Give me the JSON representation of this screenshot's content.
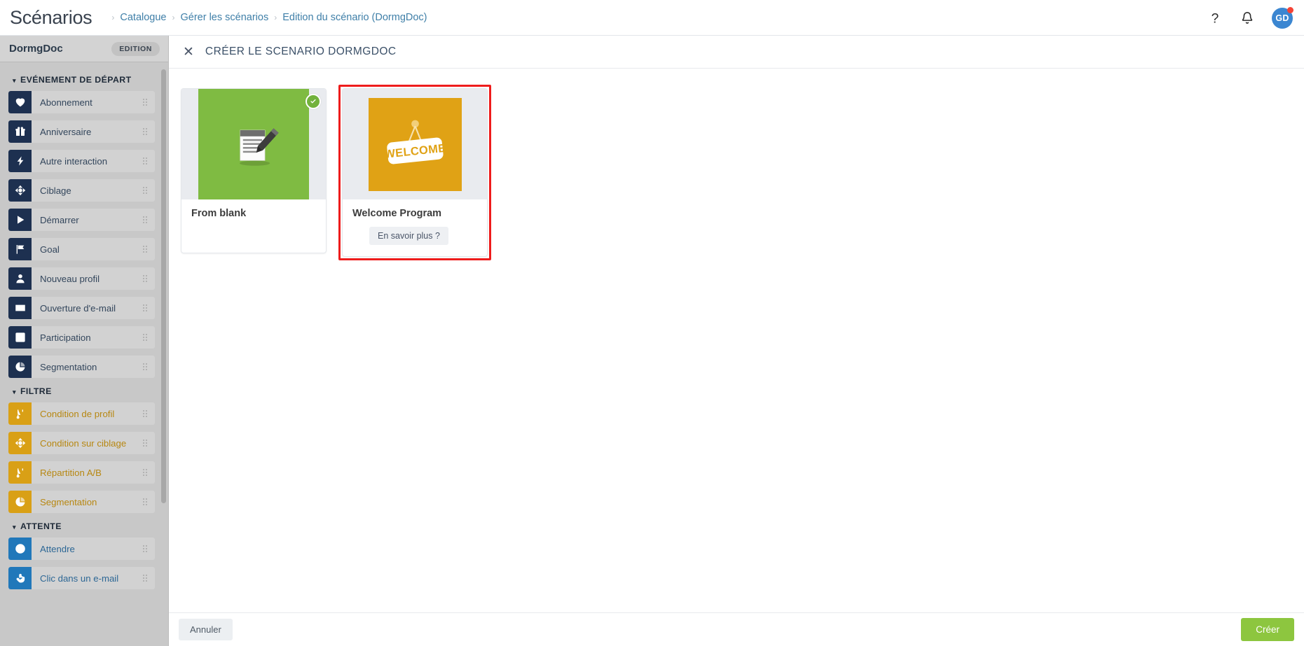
{
  "header": {
    "app_title": "Scénarios",
    "breadcrumb": [
      "Catalogue",
      "Gérer les scénarios",
      "Edition du scénario (DormgDoc)"
    ],
    "separator": "›",
    "help_icon": "question-mark-icon",
    "bell_icon": "bell-icon",
    "avatar_initials": "GD",
    "notification_dot_color": "#f54336",
    "avatar_color": "#3b86d1"
  },
  "sidebar": {
    "doc_name": "DormgDoc",
    "edition_badge": "EDITION",
    "sections": [
      {
        "label": "EVÉNEMENT DE DÉPART",
        "variant": "v-dark",
        "items": [
          {
            "label": "Abonnement",
            "icon": "heart-icon"
          },
          {
            "label": "Anniversaire",
            "icon": "gift-icon"
          },
          {
            "label": "Autre interaction",
            "icon": "bolt-icon"
          },
          {
            "label": "Ciblage",
            "icon": "target-move-icon"
          },
          {
            "label": "Démarrer",
            "icon": "play-icon"
          },
          {
            "label": "Goal",
            "icon": "flag-icon"
          },
          {
            "label": "Nouveau profil",
            "icon": "user-icon"
          },
          {
            "label": "Ouverture d'e-mail",
            "icon": "envelope-open-icon"
          },
          {
            "label": "Participation",
            "icon": "checkbox-icon"
          },
          {
            "label": "Segmentation",
            "icon": "pie-chart-icon"
          }
        ]
      },
      {
        "label": "FILTRE",
        "variant": "v-gold",
        "items": [
          {
            "label": "Condition de profil",
            "icon": "branch-icon"
          },
          {
            "label": "Condition sur ciblage",
            "icon": "target-move-icon"
          },
          {
            "label": "Répartition A/B",
            "icon": "branch-icon"
          },
          {
            "label": "Segmentation",
            "icon": "pie-chart-icon"
          }
        ]
      },
      {
        "label": "ATTENTE",
        "variant": "v-blue",
        "items": [
          {
            "label": "Attendre",
            "icon": "clock-icon"
          },
          {
            "label": "Clic dans un e-mail",
            "icon": "hand-pointer-icon"
          }
        ]
      }
    ]
  },
  "modal": {
    "close_icon": "close-icon",
    "title": "CRÉER LE SCENARIO DORMGDOC",
    "cards": [
      {
        "title": "From blank",
        "thumb_kind": "green",
        "thumb_icon": "document-pencil-icon",
        "thumb_color": "#7fbb42",
        "selected": true,
        "highlighted": false,
        "learn_more": null
      },
      {
        "title": "Welcome Program",
        "thumb_kind": "gold",
        "thumb_icon": "welcome-sign-icon",
        "thumb_text": "WELCOME",
        "thumb_color": "#e0a215",
        "selected": false,
        "highlighted": true,
        "highlight_color": "#ee1c1c",
        "learn_more": "En savoir plus ?"
      }
    ],
    "footer": {
      "cancel_label": "Annuler",
      "create_label": "Créer",
      "create_color": "#8dc63f"
    }
  }
}
